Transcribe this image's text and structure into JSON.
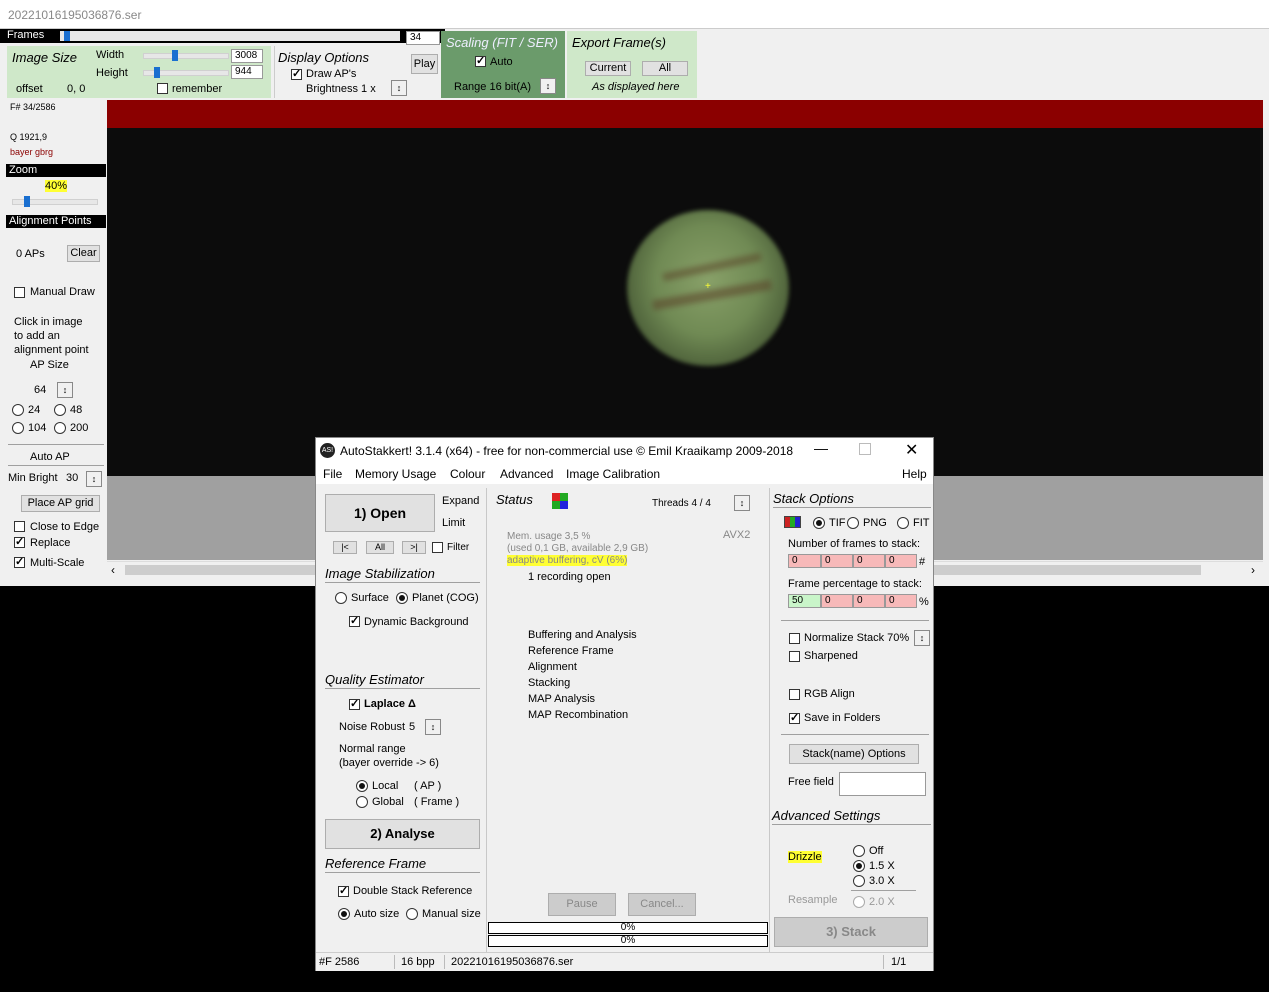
{
  "viewer": {
    "title": "20221016195036876.ser",
    "frames_label": "Frames",
    "frame_value": "34",
    "frame_fraction": 0.013,
    "image_size": {
      "title": "Image Size",
      "width_label": "Width",
      "width_value": "3008",
      "height_label": "Height",
      "height_value": "944",
      "offset_label": "offset",
      "offset_value": "0, 0",
      "remember_label": "remember"
    },
    "display_options": {
      "title": "Display Options",
      "draw_aps_label": "Draw AP's",
      "brightness_label": "Brightness 1 x",
      "play_label": "Play"
    },
    "scaling": {
      "title": "Scaling (FIT / SER)",
      "auto_label": "Auto",
      "range_label": "Range 16 bit(A)"
    },
    "export": {
      "title": "Export Frame(s)",
      "current_label": "Current",
      "all_label": "All",
      "note": "As displayed here"
    },
    "side": {
      "frame_info": "F# 34/2586",
      "quality": "Q  1921,9",
      "bayer": "bayer gbrg",
      "zoom_label": "Zoom",
      "zoom_value": "40%",
      "alignment_points_label": "Alignment Points",
      "ap_count": "0 APs",
      "clear_label": "Clear",
      "manual_draw_label": "Manual Draw",
      "click_hint": [
        "Click in image",
        "to add an",
        "alignment point"
      ],
      "ap_size_label": "AP Size",
      "ap_size_value": "64",
      "ap_options": [
        "24",
        "48",
        "104",
        "200"
      ],
      "auto_ap_label": "Auto AP",
      "min_bright_label": "Min Bright",
      "min_bright_value": "30",
      "place_grid_label": "Place AP grid",
      "close_to_edge_label": "Close to Edge",
      "replace_label": "Replace",
      "multi_scale_label": "Multi-Scale"
    }
  },
  "dialog": {
    "title": "AutoStakkert! 3.1.4 (x64) - free for non-commercial use © Emil Kraaikamp 2009-2018",
    "menu": [
      "File",
      "Memory Usage",
      "Colour",
      "Advanced",
      "Image Calibration"
    ],
    "help": "Help",
    "open_label": "1) Open",
    "expand_label": "Expand",
    "limit_label": "Limit",
    "nav": [
      "|<",
      "All",
      ">|"
    ],
    "filter_label": "Filter",
    "image_stabilization": {
      "title": "Image Stabilization",
      "surface": "Surface",
      "planet": "Planet (COG)",
      "dynamic_bg": "Dynamic Background"
    },
    "quality_estimator": {
      "title": "Quality Estimator",
      "laplace": "Laplace Δ",
      "noise_robust": "Noise Robust",
      "noise_value": "5",
      "normal_range": "Normal range",
      "bayer_override": "(bayer override -> 6)",
      "local": "Local",
      "local_tag": "( AP )",
      "global": "Global",
      "global_tag": "( Frame )"
    },
    "analyse_label": "2) Analyse",
    "reference_frame": {
      "title": "Reference Frame",
      "double_stack": "Double Stack Reference",
      "auto_size": "Auto size",
      "manual_size": "Manual size"
    },
    "status": {
      "title": "Status",
      "threads": "Threads 4 / 4",
      "avx": "AVX2",
      "mem_usage": "Mem. usage 3,5 %",
      "mem_detail": "(used 0,1 GB, available 2,9 GB)",
      "buffering": "adaptive buffering, cV (6%)",
      "recording": "1 recording open",
      "steps": [
        "Buffering and Analysis",
        "Reference Frame",
        "Alignment",
        "Stacking",
        "MAP Analysis",
        "MAP Recombination"
      ],
      "pause_label": "Pause",
      "cancel_label": "Cancel...",
      "progress1": "0%",
      "progress2": "0%"
    },
    "stack_options": {
      "title": "Stack Options",
      "formats": [
        "TIF",
        "PNG",
        "FIT"
      ],
      "frames_to_stack_label": "Number of frames to stack:",
      "frames_to_stack": [
        "0",
        "0",
        "0",
        "0"
      ],
      "frames_unit": "#",
      "percent_label": "Frame percentage to stack:",
      "percent_values": [
        "50",
        "0",
        "0",
        "0"
      ],
      "percent_unit": "%",
      "normalize": "Normalize Stack 70%",
      "sharpened": "Sharpened",
      "rgb_align": "RGB Align",
      "save_folders": "Save in Folders",
      "stackname_btn": "Stack(name) Options",
      "free_field": "Free field"
    },
    "advanced": {
      "title": "Advanced Settings",
      "drizzle": "Drizzle",
      "drizzle_options": [
        "Off",
        "1.5 X",
        "3.0 X"
      ],
      "resample": "Resample",
      "resample_option": "2.0 X",
      "stack_label": "3) Stack"
    },
    "statusbar": {
      "frames": "#F 2586",
      "bpp": "16 bpp",
      "file": "20221016195036876.ser",
      "page": "1/1"
    }
  },
  "colors": {
    "red_bar": "#8b0000",
    "green_panel": "#cfe8c9",
    "dark_green": "#6b9b6b",
    "highlight": "#ffff33"
  }
}
